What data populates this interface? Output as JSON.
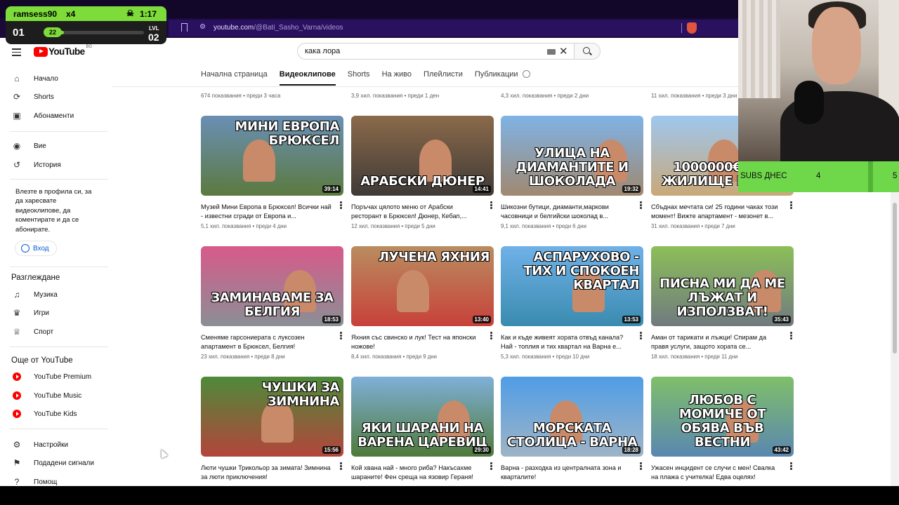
{
  "browser": {
    "url_host": "youtube.com",
    "url_path": "/@Bati_Sasho_Varna/videos"
  },
  "overlay": {
    "user": "ramsess90",
    "multiplier": "x4",
    "timer": "1:17",
    "level_left": "01",
    "progress_value": "22",
    "lvl_label": "LVL",
    "level_right": "02"
  },
  "youtube": {
    "logo_text": "YouTube",
    "country": "BG",
    "search_value": "кака лора",
    "sidebar": {
      "main": [
        {
          "label": "Начало",
          "icon": "home-icon"
        },
        {
          "label": "Shorts",
          "icon": "shorts-icon"
        },
        {
          "label": "Абонаменти",
          "icon": "subscriptions-icon"
        }
      ],
      "you": [
        {
          "label": "Вие",
          "icon": "account-icon"
        },
        {
          "label": "История",
          "icon": "history-icon"
        }
      ],
      "signin_note": "Влезте в профила си, за да харесвате видеоклипове, да коментирате и да се абонирате.",
      "signin_label": "Вход",
      "explore_heading": "Разглеждане",
      "explore": [
        {
          "label": "Музика",
          "icon": "music-icon"
        },
        {
          "label": "Игри",
          "icon": "gaming-icon"
        },
        {
          "label": "Спорт",
          "icon": "trophy-icon"
        }
      ],
      "more_heading": "Още от YouTube",
      "more": [
        {
          "label": "YouTube Premium"
        },
        {
          "label": "YouTube Music"
        },
        {
          "label": "YouTube Kids"
        }
      ],
      "settings": [
        {
          "label": "Настройки",
          "icon": "gear-icon"
        },
        {
          "label": "Подадени сигнали",
          "icon": "flag-icon"
        },
        {
          "label": "Помощ",
          "icon": "help-icon"
        }
      ]
    },
    "tabs": [
      "Начална страница",
      "Видеоклипове",
      "Shorts",
      "На живо",
      "Плейлисти",
      "Публикации"
    ],
    "active_tab": "Видеоклипове",
    "prev_row": [
      {
        "title": "674 показвания",
        "meta": "674 показвания • преди 3 часа"
      },
      {
        "meta": "3,9 хил. показвания • преди 1 ден"
      },
      {
        "meta": "4,3 хил. показвания • преди 2 дни"
      },
      {
        "meta": "11 хил. показвания • преди 3 дни"
      }
    ],
    "videos": [
      {
        "caption": "МИНИ ЕВРОПА БРЮКСЕЛ",
        "caption_pos": "top",
        "duration": "39:14",
        "title": "Музей Мини Европа в Брюксел! Всички най - известни сгради от Европа и...",
        "meta": "5,1 хил. показвания • преди 4 дни",
        "bg1": "#6a8fb5",
        "bg2": "#5b7a3f"
      },
      {
        "caption": "АРАБСКИ ДЮНЕР",
        "caption_pos": "bottom",
        "duration": "14:41",
        "title": "Поръчах цялото меню от Арабски ресторант в Брюксел! Дюнер, Кебап,...",
        "meta": "12 хил. показвания • преди 5 дни",
        "bg1": "#8b6a4a",
        "bg2": "#3f3a36"
      },
      {
        "caption": "УЛИЦА НА ДИАМАНТИТЕ И ШОКОЛАДА",
        "caption_pos": "bottom",
        "duration": "19:32",
        "title": "Шикозни бутици, диаманти,маркови часовници и белгийски шоколад в...",
        "meta": "9,1 хил. показвания • преди 6 дни",
        "bg1": "#7fb3e6",
        "bg2": "#a08870"
      },
      {
        "caption": "1000000€ СТР ЖИЛИЩЕ В БРЮ",
        "caption_pos": "bottom",
        "duration": "",
        "title": "Сбъднах мечтата си! 25 години чаках този момент! Вижте апартамент - мезонет в...",
        "meta": "31 хил. показвания • преди 7 дни",
        "bg1": "#9ec7ef",
        "bg2": "#c9a878"
      },
      {
        "caption": "ЗАМИНАВАМЕ ЗА БЕЛГИЯ",
        "caption_pos": "bottom",
        "duration": "18:53",
        "title": "Сменяме гарсониерата с луксозен апартамент в Брюксел, Белгия!",
        "meta": "23 хил. показвания • преди 8 дни",
        "bg1": "#d85a8a",
        "bg2": "#8a8f96"
      },
      {
        "caption": "ЛУЧЕНА ЯХНИЯ",
        "caption_pos": "top",
        "duration": "13:40",
        "title": "Яхния със свинско и лук! Тест на японски ножове!",
        "meta": "8,4 хил. показвания • преди 9 дни",
        "bg1": "#b98d5f",
        "bg2": "#c8413a"
      },
      {
        "caption": "АСПАРУХОВО - ТИХ И СПОКОЕН КВАРТАЛ",
        "caption_pos": "top",
        "duration": "13:53",
        "title": "Как и къде живеят хората отвъд канала? Най - топлия и тих квартал на Варна е...",
        "meta": "5,3 хил. показвания • преди 10 дни",
        "bg1": "#6fb1e8",
        "bg2": "#3a8bb0"
      },
      {
        "caption": "ПИСНА МИ ДА МЕ ЛЪЖАТ И ИЗПОЛЗВАТ!",
        "caption_pos": "bottom",
        "duration": "35:43",
        "title": "Аман от тарикати и лъжци! Спирам да правя услуги, защото хората се...",
        "meta": "18 хил. показвания • преди 11 дни",
        "bg1": "#8cbf58",
        "bg2": "#707a80"
      },
      {
        "caption": "ЧУШКИ ЗА ЗИМНИНА",
        "caption_pos": "top",
        "duration": "15:56",
        "title": "Люти чушки Трикольор за зимата! Зимнина за люти приключения!",
        "meta": "",
        "bg1": "#4e8a3a",
        "bg2": "#b3453b"
      },
      {
        "caption": "ЯКИ ШАРАНИ НА ВАРЕНА ЦАРЕВИЦ",
        "caption_pos": "bottom",
        "duration": "29:30",
        "title": "Кой хвана най - много риба? Накъсахме шараните! Фен среща на язовир Гераня!",
        "meta": "",
        "bg1": "#7fb0d8",
        "bg2": "#4f7a3a"
      },
      {
        "caption": "МОРСКАТА СТОЛИЦА - ВАРНА",
        "caption_pos": "bottom",
        "duration": "18:28",
        "title": "Варна - разходка из централната зона и кварталите!",
        "meta": "",
        "bg1": "#4f9de6",
        "bg2": "#9fb4c6"
      },
      {
        "caption": "ЛЮБОВ С МОМИЧЕ ОТ ОБЯВА ВЪВ ВЕСТНИ",
        "caption_pos": "bottom",
        "duration": "43:42",
        "title": "Ужасен инцидент се случи с мен! Свалка на плажа с учителка! Едва оцелях!",
        "meta": "",
        "bg1": "#7fbf6a",
        "bg2": "#5a87b0"
      }
    ]
  },
  "stream": {
    "subs_label": "SUBS ДНЕС",
    "subs_count": "4",
    "subs_next": "5"
  }
}
